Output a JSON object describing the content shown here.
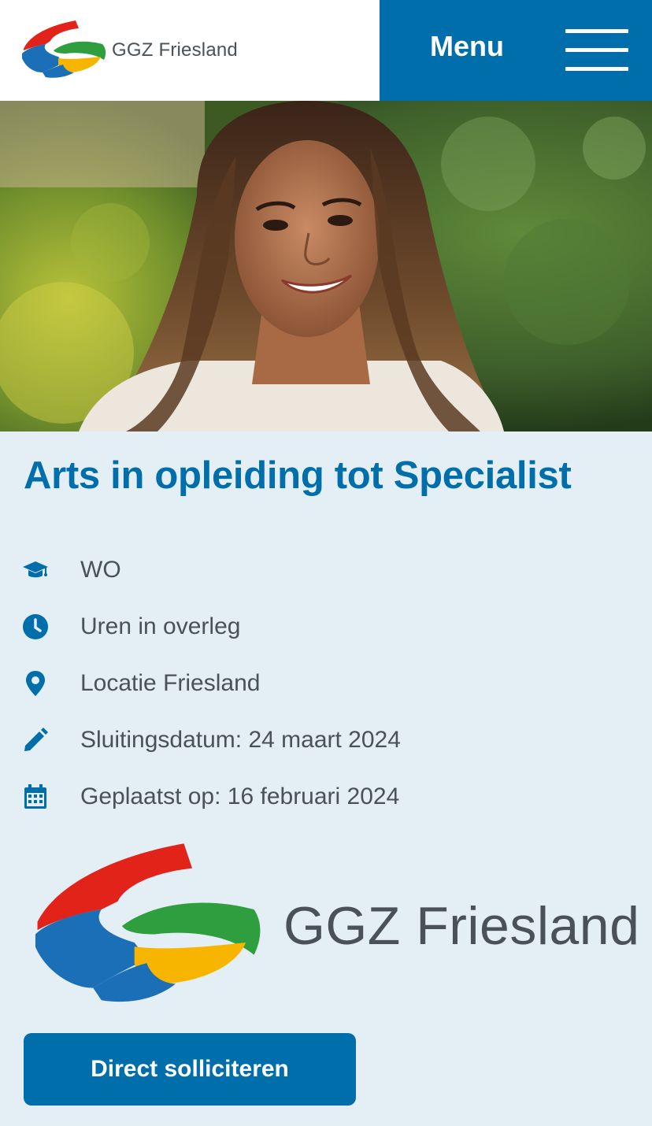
{
  "header": {
    "logo_text": "GGZ Friesland",
    "logo_icon": "ggz-friesland-logo-icon",
    "menu_label": "Menu",
    "menu_icon": "hamburger-icon"
  },
  "colors": {
    "brand_blue": "#006eaa",
    "page_background": "#e4eef5",
    "text_gray": "#4a5159",
    "logo_red": "#e2231a",
    "logo_green": "#2e9e3e",
    "logo_yellow": "#f7b500",
    "logo_blue": "#1b6fb6"
  },
  "hero": {
    "image_alt": ""
  },
  "job": {
    "title": "Arts in opleiding tot Specialist",
    "details": [
      {
        "icon": "graduation-cap-icon",
        "text": "WO"
      },
      {
        "icon": "clock-icon",
        "text": "Uren in overleg"
      },
      {
        "icon": "location-pin-icon",
        "text": "Locatie Friesland"
      },
      {
        "icon": "pencil-icon",
        "text": "Sluitingsdatum: 24 maart 2024"
      },
      {
        "icon": "calendar-icon",
        "text": "Geplaatst op: 16 februari 2024"
      }
    ]
  },
  "company_logo": {
    "text": "GGZ Friesland"
  },
  "apply": {
    "label": "Direct solliciteren"
  }
}
